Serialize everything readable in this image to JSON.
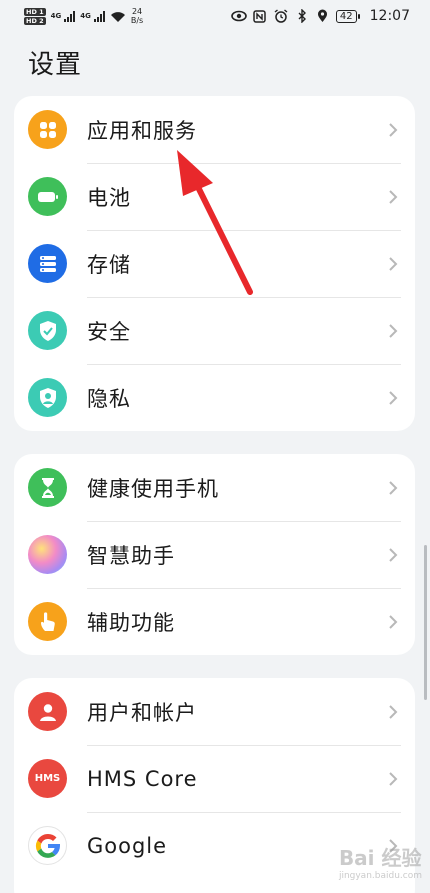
{
  "status_bar": {
    "sim1": "HD 1",
    "sim2": "HD 2",
    "net1": "4G",
    "net2": "4G",
    "speed_value": "24",
    "speed_unit": "B/s",
    "battery": "42",
    "time": "12:07"
  },
  "page_title": "设置",
  "groups": [
    {
      "items": [
        {
          "label": "应用和服务",
          "icon": "apps-icon",
          "color": "#f7a21b"
        },
        {
          "label": "电池",
          "icon": "battery-icon",
          "color": "#3fbf5a"
        },
        {
          "label": "存储",
          "icon": "storage-icon",
          "color": "#1f6ce5"
        },
        {
          "label": "安全",
          "icon": "shield-icon",
          "color": "#3ccbb4"
        },
        {
          "label": "隐私",
          "icon": "privacy-icon",
          "color": "#3ccbb4"
        }
      ]
    },
    {
      "items": [
        {
          "label": "健康使用手机",
          "icon": "hourglass-icon",
          "color": "#3fbf5a"
        },
        {
          "label": "智慧助手",
          "icon": "assistant-icon",
          "color": "#d87ad0"
        },
        {
          "label": "辅助功能",
          "icon": "hand-icon",
          "color": "#f7a21b"
        }
      ]
    },
    {
      "items": [
        {
          "label": "用户和帐户",
          "icon": "user-icon",
          "color": "#e9483f"
        },
        {
          "label": "HMS Core",
          "icon": "hms-icon",
          "icon_text": "HMS",
          "color": "#e9483f"
        },
        {
          "label": "Google",
          "icon": "google-icon",
          "color": "#ffffff"
        }
      ]
    }
  ],
  "annotation_color": "#e8282b",
  "watermark": {
    "text": "Bai 经验",
    "sub": "jingyan.baidu.com"
  }
}
